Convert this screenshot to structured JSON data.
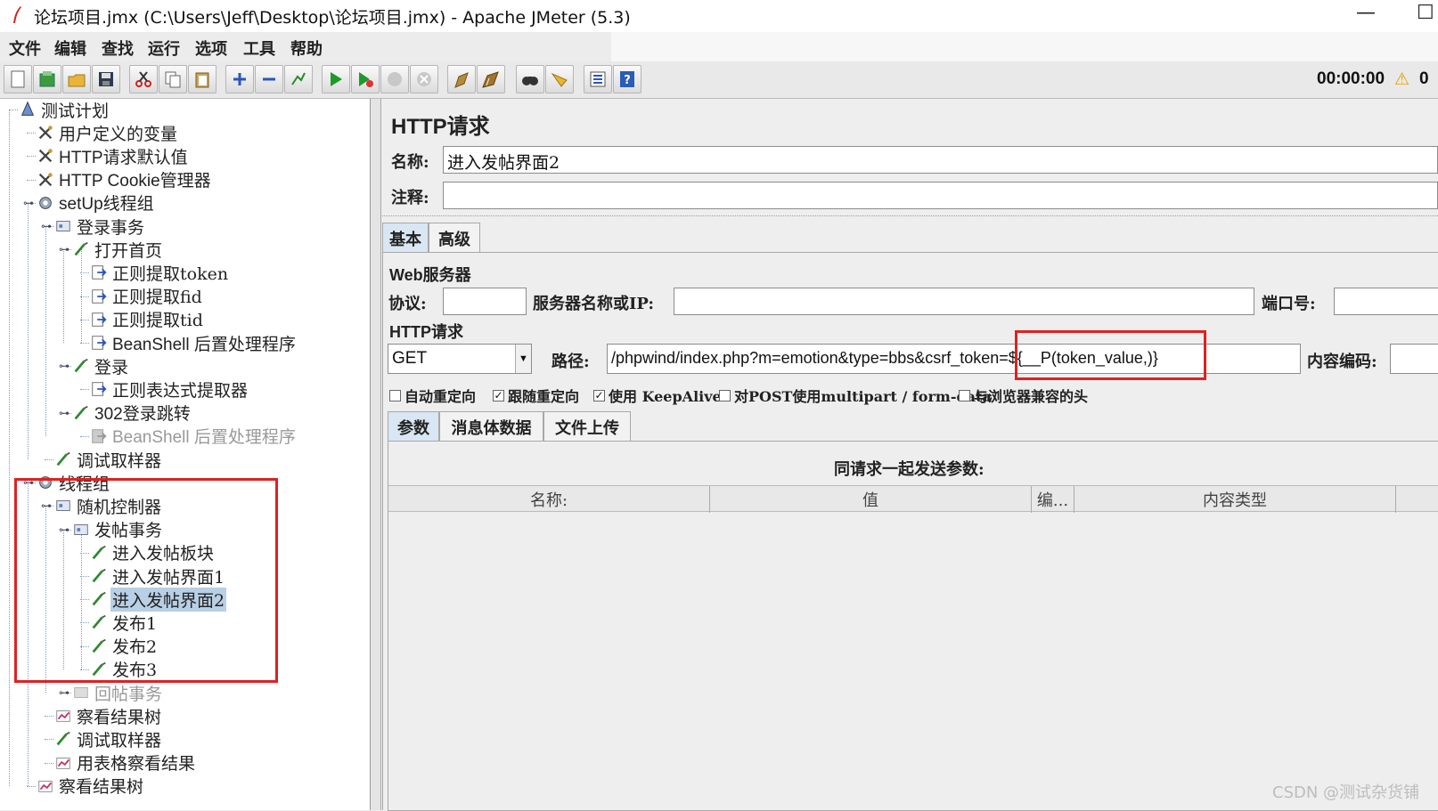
{
  "window": {
    "title": "论坛项目.jmx (C:\\Users\\Jeff\\Desktop\\论坛项目.jmx) - Apache JMeter (5.3)",
    "minimize": "—",
    "maximize": "☐"
  },
  "menu": [
    "文件",
    "编辑",
    "查找",
    "运行",
    "选项",
    "工具",
    "帮助"
  ],
  "toolbar": {
    "timer": "00:00:00",
    "warn_icon": "⚠",
    "warn_count": "0",
    "buttons": [
      "new-icon",
      "templates-icon",
      "open-icon",
      "save-icon",
      "cut-icon",
      "copy-icon",
      "paste-icon",
      "expand-icon",
      "collapse-icon",
      "toggle-icon",
      "start-icon",
      "start-no-pause-icon",
      "stop-icon",
      "shutdown-icon",
      "clear-icon",
      "clear-all-icon",
      "search-icon",
      "reset-search-icon",
      "function-helper-icon",
      "help-icon"
    ]
  },
  "tree": [
    {
      "label": "测试计划",
      "en": false
    },
    {
      "label": "用户定义的变量",
      "en": false
    },
    {
      "label": "HTTP请求默认值",
      "en": true
    },
    {
      "label": "HTTP Cookie管理器",
      "en": true
    },
    {
      "label": "setUp线程组",
      "en": true
    },
    {
      "label": "登录事务",
      "en": false
    },
    {
      "label": "打开首页",
      "en": false
    },
    {
      "label": "正则提取token",
      "en": false
    },
    {
      "label": "正则提取fid",
      "en": false
    },
    {
      "label": "正则提取tid",
      "en": false
    },
    {
      "label": "BeanShell 后置处理程序",
      "en": true
    },
    {
      "label": "登录",
      "en": false
    },
    {
      "label": "正则表达式提取器",
      "en": false
    },
    {
      "label": "302登录跳转",
      "en": true
    },
    {
      "label": "BeanShell 后置处理程序",
      "en": true
    },
    {
      "label": "调试取样器",
      "en": false
    },
    {
      "label": "线程组",
      "en": false
    },
    {
      "label": "随机控制器",
      "en": false
    },
    {
      "label": "发帖事务",
      "en": false
    },
    {
      "label": "进入发帖板块",
      "en": false
    },
    {
      "label": "进入发帖界面1",
      "en": false
    },
    {
      "label": "进入发帖界面2",
      "en": false
    },
    {
      "label": "发布1",
      "en": false
    },
    {
      "label": "发布2",
      "en": false
    },
    {
      "label": "发布3",
      "en": false
    },
    {
      "label": "回帖事务",
      "en": false
    },
    {
      "label": "察看结果树",
      "en": false
    },
    {
      "label": "调试取样器",
      "en": false
    },
    {
      "label": "用表格察看结果",
      "en": false
    },
    {
      "label": "察看结果树",
      "en": false
    }
  ],
  "panel": {
    "title": "HTTP请求",
    "name_label": "名称:",
    "name_value": "进入发帖界面2",
    "comment_label": "注释:",
    "comment_value": "",
    "tabs": [
      "基本",
      "高级"
    ],
    "web_server_label": "Web服务器",
    "protocol_label": "协议:",
    "protocol_value": "",
    "server_label": "服务器名称或IP:",
    "server_value": "",
    "port_label": "端口号:",
    "port_value": "",
    "http_request_label": "HTTP请求",
    "method_value": "GET",
    "path_label": "路径:",
    "path_value": "/phpwind/index.php?m=emotion&type=bbs&csrf_token=${__P(token_value,)}",
    "encoding_label": "内容编码:",
    "checkboxes": [
      {
        "label": "自动重定向",
        "checked": false
      },
      {
        "label": "跟随重定向",
        "checked": true
      },
      {
        "label": "使用 KeepAlive",
        "checked": true
      },
      {
        "label": "对POST使用multipart / form-data",
        "checked": false
      },
      {
        "label": "与浏览器兼容的头",
        "checked": false
      }
    ],
    "subtabs": [
      "参数",
      "消息体数据",
      "文件上传"
    ],
    "params_title": "同请求一起发送参数:",
    "columns": [
      "名称:",
      "值",
      "编...",
      "内容类型"
    ]
  },
  "watermark": "CSDN @测试杂货铺"
}
